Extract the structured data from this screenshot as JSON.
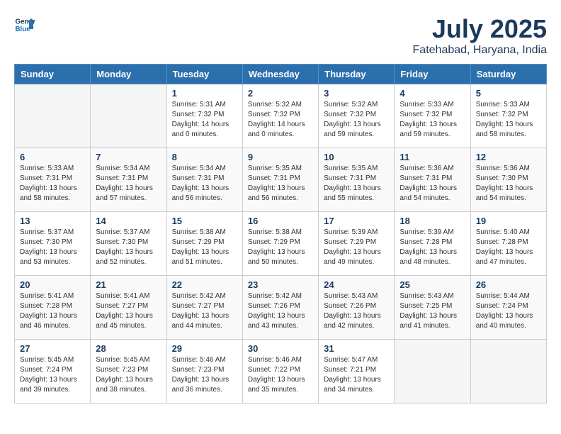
{
  "header": {
    "logo_line1": "General",
    "logo_line2": "Blue",
    "month_year": "July 2025",
    "location": "Fatehabad, Haryana, India"
  },
  "weekdays": [
    "Sunday",
    "Monday",
    "Tuesday",
    "Wednesday",
    "Thursday",
    "Friday",
    "Saturday"
  ],
  "weeks": [
    [
      {
        "day": "",
        "sunrise": "",
        "sunset": "",
        "daylight": ""
      },
      {
        "day": "",
        "sunrise": "",
        "sunset": "",
        "daylight": ""
      },
      {
        "day": "1",
        "sunrise": "Sunrise: 5:31 AM",
        "sunset": "Sunset: 7:32 PM",
        "daylight": "Daylight: 14 hours and 0 minutes."
      },
      {
        "day": "2",
        "sunrise": "Sunrise: 5:32 AM",
        "sunset": "Sunset: 7:32 PM",
        "daylight": "Daylight: 14 hours and 0 minutes."
      },
      {
        "day": "3",
        "sunrise": "Sunrise: 5:32 AM",
        "sunset": "Sunset: 7:32 PM",
        "daylight": "Daylight: 13 hours and 59 minutes."
      },
      {
        "day": "4",
        "sunrise": "Sunrise: 5:33 AM",
        "sunset": "Sunset: 7:32 PM",
        "daylight": "Daylight: 13 hours and 59 minutes."
      },
      {
        "day": "5",
        "sunrise": "Sunrise: 5:33 AM",
        "sunset": "Sunset: 7:32 PM",
        "daylight": "Daylight: 13 hours and 58 minutes."
      }
    ],
    [
      {
        "day": "6",
        "sunrise": "Sunrise: 5:33 AM",
        "sunset": "Sunset: 7:31 PM",
        "daylight": "Daylight: 13 hours and 58 minutes."
      },
      {
        "day": "7",
        "sunrise": "Sunrise: 5:34 AM",
        "sunset": "Sunset: 7:31 PM",
        "daylight": "Daylight: 13 hours and 57 minutes."
      },
      {
        "day": "8",
        "sunrise": "Sunrise: 5:34 AM",
        "sunset": "Sunset: 7:31 PM",
        "daylight": "Daylight: 13 hours and 56 minutes."
      },
      {
        "day": "9",
        "sunrise": "Sunrise: 5:35 AM",
        "sunset": "Sunset: 7:31 PM",
        "daylight": "Daylight: 13 hours and 56 minutes."
      },
      {
        "day": "10",
        "sunrise": "Sunrise: 5:35 AM",
        "sunset": "Sunset: 7:31 PM",
        "daylight": "Daylight: 13 hours and 55 minutes."
      },
      {
        "day": "11",
        "sunrise": "Sunrise: 5:36 AM",
        "sunset": "Sunset: 7:31 PM",
        "daylight": "Daylight: 13 hours and 54 minutes."
      },
      {
        "day": "12",
        "sunrise": "Sunrise: 5:36 AM",
        "sunset": "Sunset: 7:30 PM",
        "daylight": "Daylight: 13 hours and 54 minutes."
      }
    ],
    [
      {
        "day": "13",
        "sunrise": "Sunrise: 5:37 AM",
        "sunset": "Sunset: 7:30 PM",
        "daylight": "Daylight: 13 hours and 53 minutes."
      },
      {
        "day": "14",
        "sunrise": "Sunrise: 5:37 AM",
        "sunset": "Sunset: 7:30 PM",
        "daylight": "Daylight: 13 hours and 52 minutes."
      },
      {
        "day": "15",
        "sunrise": "Sunrise: 5:38 AM",
        "sunset": "Sunset: 7:29 PM",
        "daylight": "Daylight: 13 hours and 51 minutes."
      },
      {
        "day": "16",
        "sunrise": "Sunrise: 5:38 AM",
        "sunset": "Sunset: 7:29 PM",
        "daylight": "Daylight: 13 hours and 50 minutes."
      },
      {
        "day": "17",
        "sunrise": "Sunrise: 5:39 AM",
        "sunset": "Sunset: 7:29 PM",
        "daylight": "Daylight: 13 hours and 49 minutes."
      },
      {
        "day": "18",
        "sunrise": "Sunrise: 5:39 AM",
        "sunset": "Sunset: 7:28 PM",
        "daylight": "Daylight: 13 hours and 48 minutes."
      },
      {
        "day": "19",
        "sunrise": "Sunrise: 5:40 AM",
        "sunset": "Sunset: 7:28 PM",
        "daylight": "Daylight: 13 hours and 47 minutes."
      }
    ],
    [
      {
        "day": "20",
        "sunrise": "Sunrise: 5:41 AM",
        "sunset": "Sunset: 7:28 PM",
        "daylight": "Daylight: 13 hours and 46 minutes."
      },
      {
        "day": "21",
        "sunrise": "Sunrise: 5:41 AM",
        "sunset": "Sunset: 7:27 PM",
        "daylight": "Daylight: 13 hours and 45 minutes."
      },
      {
        "day": "22",
        "sunrise": "Sunrise: 5:42 AM",
        "sunset": "Sunset: 7:27 PM",
        "daylight": "Daylight: 13 hours and 44 minutes."
      },
      {
        "day": "23",
        "sunrise": "Sunrise: 5:42 AM",
        "sunset": "Sunset: 7:26 PM",
        "daylight": "Daylight: 13 hours and 43 minutes."
      },
      {
        "day": "24",
        "sunrise": "Sunrise: 5:43 AM",
        "sunset": "Sunset: 7:26 PM",
        "daylight": "Daylight: 13 hours and 42 minutes."
      },
      {
        "day": "25",
        "sunrise": "Sunrise: 5:43 AM",
        "sunset": "Sunset: 7:25 PM",
        "daylight": "Daylight: 13 hours and 41 minutes."
      },
      {
        "day": "26",
        "sunrise": "Sunrise: 5:44 AM",
        "sunset": "Sunset: 7:24 PM",
        "daylight": "Daylight: 13 hours and 40 minutes."
      }
    ],
    [
      {
        "day": "27",
        "sunrise": "Sunrise: 5:45 AM",
        "sunset": "Sunset: 7:24 PM",
        "daylight": "Daylight: 13 hours and 39 minutes."
      },
      {
        "day": "28",
        "sunrise": "Sunrise: 5:45 AM",
        "sunset": "Sunset: 7:23 PM",
        "daylight": "Daylight: 13 hours and 38 minutes."
      },
      {
        "day": "29",
        "sunrise": "Sunrise: 5:46 AM",
        "sunset": "Sunset: 7:23 PM",
        "daylight": "Daylight: 13 hours and 36 minutes."
      },
      {
        "day": "30",
        "sunrise": "Sunrise: 5:46 AM",
        "sunset": "Sunset: 7:22 PM",
        "daylight": "Daylight: 13 hours and 35 minutes."
      },
      {
        "day": "31",
        "sunrise": "Sunrise: 5:47 AM",
        "sunset": "Sunset: 7:21 PM",
        "daylight": "Daylight: 13 hours and 34 minutes."
      },
      {
        "day": "",
        "sunrise": "",
        "sunset": "",
        "daylight": ""
      },
      {
        "day": "",
        "sunrise": "",
        "sunset": "",
        "daylight": ""
      }
    ]
  ]
}
